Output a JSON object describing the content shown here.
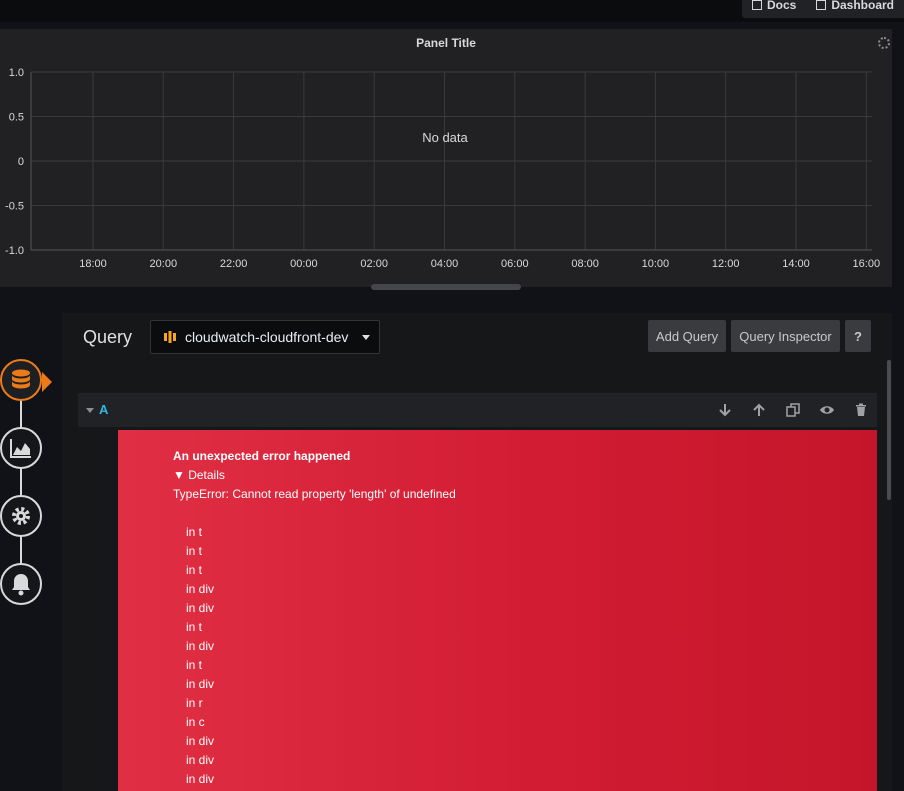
{
  "topbar": {
    "links": [
      {
        "label": "Docs",
        "icon": "external-link-icon"
      },
      {
        "label": "Dashboard",
        "icon": "external-link-icon"
      }
    ]
  },
  "panel": {
    "title": "Panel Title",
    "no_data": "No data",
    "loading_icon": "spinner-icon"
  },
  "chart_data": {
    "type": "line",
    "title": "Panel Title",
    "x_ticks": [
      "18:00",
      "20:00",
      "22:00",
      "00:00",
      "02:00",
      "04:00",
      "06:00",
      "08:00",
      "10:00",
      "12:00",
      "14:00",
      "16:00"
    ],
    "y_ticks": [
      "1.0",
      "0.5",
      "0",
      "-0.5",
      "-1.0"
    ],
    "ylim": [
      -1.0,
      1.0
    ],
    "series": [],
    "grid": true,
    "annotation": "No data"
  },
  "query": {
    "label": "Query",
    "datasource": "cloudwatch-cloudfront-dev",
    "datasource_icon": "aws-icon",
    "buttons": {
      "add": "Add Query",
      "inspector": "Query Inspector",
      "help": "?"
    }
  },
  "query_row": {
    "ref_id": "A",
    "actions": [
      "move-down-icon",
      "move-up-icon",
      "duplicate-icon",
      "eye-icon",
      "trash-icon"
    ]
  },
  "error": {
    "title": "An unexpected error happened",
    "details_label": "▼ Details",
    "message": "TypeError: Cannot read property 'length' of undefined",
    "stack": [
      "in t",
      "in t",
      "in t",
      "in div",
      "in div",
      "in t",
      "in div",
      "in t",
      "in div",
      "in r",
      "in c",
      "in div",
      "in div",
      "in div"
    ]
  },
  "sidenav": {
    "items": [
      {
        "icon": "database-icon",
        "active": true
      },
      {
        "icon": "chart-icon",
        "active": false
      },
      {
        "icon": "gear-icon",
        "active": false
      },
      {
        "icon": "bell-icon",
        "active": false
      }
    ],
    "accent": "#eb7b18"
  }
}
